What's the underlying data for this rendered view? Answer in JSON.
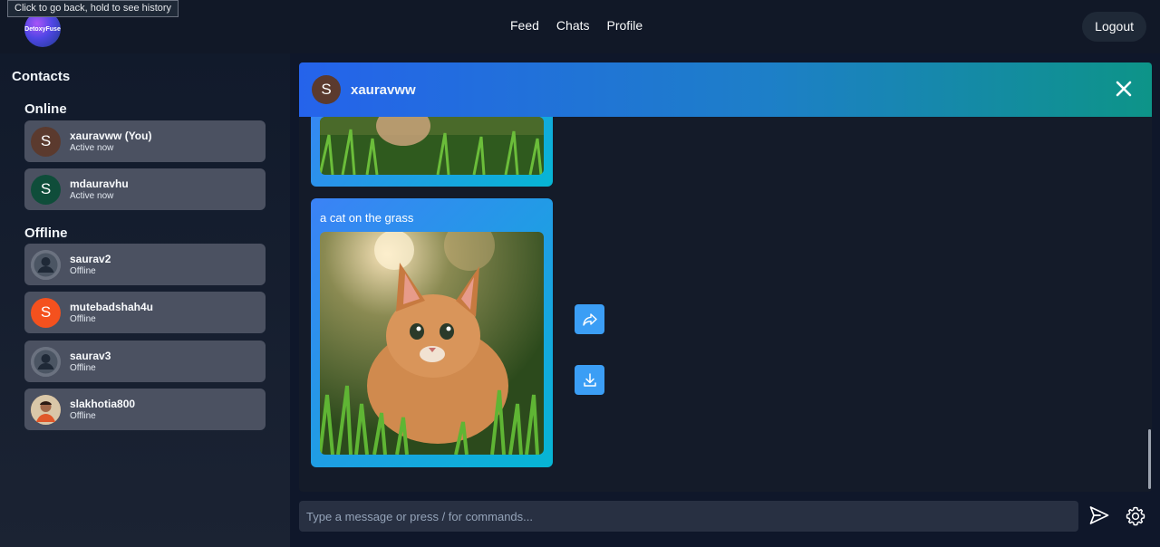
{
  "tooltip": "Click to go back, hold to see history",
  "logo_text": "DetoxyFuse",
  "nav": {
    "feed": "Feed",
    "chats": "Chats",
    "profile": "Profile"
  },
  "logout": "Logout",
  "sidebar": {
    "title": "Contacts",
    "online_title": "Online",
    "offline_title": "Offline",
    "online": [
      {
        "initial": "S",
        "name": "xauravww (You)",
        "status": "Active now",
        "color": "#5b3a2e"
      },
      {
        "initial": "S",
        "name": "mdauravhu",
        "status": "Active now",
        "color": "#0f4d3a"
      }
    ],
    "offline": [
      {
        "initial": "",
        "name": "saurav2",
        "status": "Offline",
        "color": "#6b7280",
        "icon": "default-user-icon"
      },
      {
        "initial": "S",
        "name": "mutebadshah4u",
        "status": "Offline",
        "color": "#f4511e"
      },
      {
        "initial": "",
        "name": "saurav3",
        "status": "Offline",
        "color": "#6b7280",
        "icon": "default-user-icon"
      },
      {
        "initial": "",
        "name": "slakhotia800",
        "status": "Offline",
        "color": "#c08457",
        "icon": "profile-photo"
      }
    ]
  },
  "chat": {
    "header_initial": "S",
    "header_name": "xauravww",
    "message_caption": "a cat on the grass",
    "accent": "#3b9ef5"
  },
  "input": {
    "placeholder": "Type a message or press / for commands..."
  }
}
